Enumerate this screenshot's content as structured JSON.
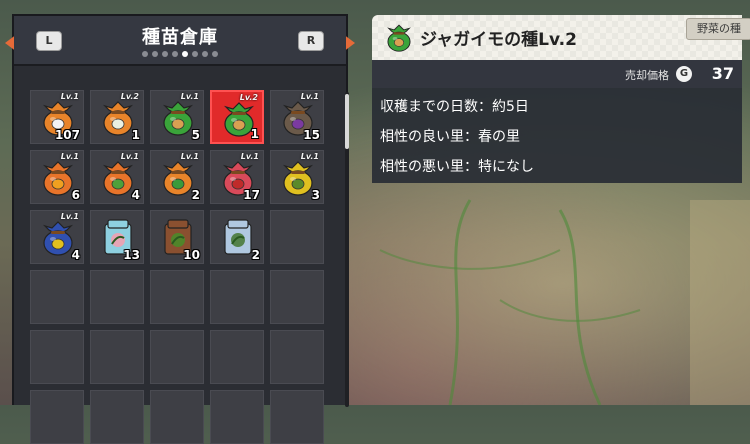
{
  "storage": {
    "title": "種苗倉庫",
    "left_button": "L",
    "right_button": "R",
    "page_count": 8,
    "active_page": 5
  },
  "slots": [
    {
      "lv": "Lv.1",
      "qty": "107",
      "bag": "#e8842a",
      "emblem": "#f4f4f4"
    },
    {
      "lv": "Lv.2",
      "qty": "1",
      "bag": "#e8842a",
      "emblem": "#eaf0e0"
    },
    {
      "lv": "Lv.1",
      "qty": "5",
      "bag": "#3aa43a",
      "emblem": "#d9a052"
    },
    {
      "lv": "Lv.2",
      "qty": "1",
      "bag": "#3aa43a",
      "emblem": "#d9a052",
      "selected": true
    },
    {
      "lv": "Lv.1",
      "qty": "15",
      "bag": "#6b5a4a",
      "emblem": "#7b3aa0"
    },
    {
      "lv": "Lv.1",
      "qty": "6",
      "bag": "#e8742a",
      "emblem": "#f0a020"
    },
    {
      "lv": "Lv.1",
      "qty": "4",
      "bag": "#e8742a",
      "emblem": "#4ea03a"
    },
    {
      "lv": "Lv.1",
      "qty": "2",
      "bag": "#e8842a",
      "emblem": "#3a9a3a"
    },
    {
      "lv": "Lv.1",
      "qty": "17",
      "bag": "#d94a5a",
      "emblem": "#c02a2a"
    },
    {
      "lv": "Lv.1",
      "qty": "3",
      "bag": "#e0c020",
      "emblem": "#5a8a2a"
    },
    {
      "lv": "Lv.1",
      "qty": "4",
      "bag": "#3050b0",
      "emblem": "#e0c020"
    },
    {
      "lv": "",
      "qty": "13",
      "bag": "#8ed0e0",
      "emblem": "#f0a0b0",
      "box": true
    },
    {
      "lv": "",
      "qty": "10",
      "bag": "#8a5030",
      "emblem": "#4a8a2a",
      "box": true
    },
    {
      "lv": "",
      "qty": "2",
      "bag": "#b0c8e0",
      "emblem": "#4a7a3a",
      "box": true
    },
    {},
    {},
    {},
    {},
    {},
    {},
    {},
    {},
    {},
    {},
    {},
    {},
    {},
    {},
    {},
    {}
  ],
  "detail": {
    "name": "ジャガイモの種Lv.2",
    "category": "野菜の種",
    "price_label": "売却価格",
    "currency_icon": "G",
    "price": "37",
    "lines": [
      "収穫までの日数：約5日",
      "相性の良い里：春の里",
      "相性の悪い里：特になし"
    ],
    "icon_colors": {
      "bag": "#3aa43a",
      "emblem": "#d9a052"
    }
  },
  "colors": {
    "accent_arrow": "#e66a38",
    "selected_slot": "#e12a2a"
  }
}
